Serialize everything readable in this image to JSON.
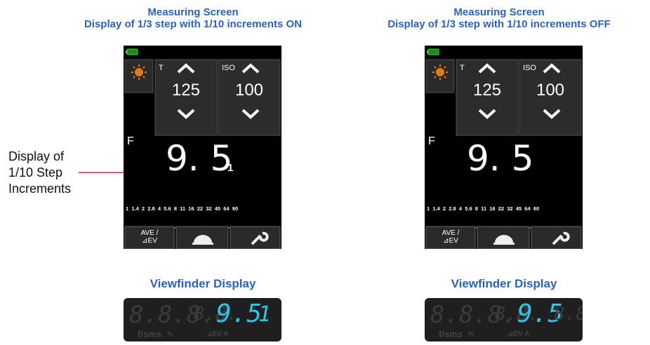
{
  "headings": [
    {
      "line1": "Measuring Screen",
      "line2": "Display of 1/3 step with 1/10 increments ON"
    },
    {
      "line1": "Measuring Screen",
      "line2": "Display of 1/3 step with 1/10 increments OFF"
    }
  ],
  "callout": {
    "lines": [
      "Display of",
      "1/10 Step",
      "Increments"
    ]
  },
  "screen": {
    "t_label": "T",
    "iso_label": "ISO",
    "t_value": "125",
    "iso_value": "100",
    "f_label": "F",
    "f_value": "9. 5",
    "tenth_step": "1",
    "scale_ticks": "1  1.4  2  2.8  4  5.6  8  11  16  22  32  45  64  90",
    "ave_label_1": "AVE /",
    "ave_label_2": "⊿EV",
    "icons": {
      "mode": "sun-icon",
      "dome": "dome-icon",
      "settings": "wrench-icon"
    },
    "accent": "#e07a1a"
  },
  "viewfinder": {
    "title": "Viewfinder Display",
    "dim_digits": "8.8.8.8",
    "dim_digits2": "8.8.",
    "value": "9.5",
    "tenth_on": "1",
    "tenth_off": "8.8",
    "unit_left": "f/sms",
    "unit_pct": "%",
    "unit_right": "⊿EV A",
    "value_color": "#28c8e8"
  }
}
